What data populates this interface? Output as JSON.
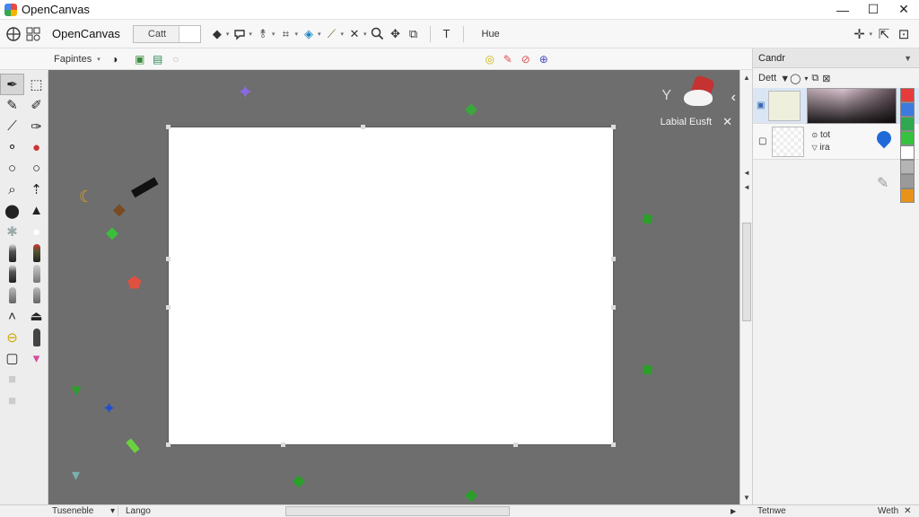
{
  "window": {
    "title": "OpenCanvas",
    "minimize": "—",
    "maximize": "☐",
    "close": "✕"
  },
  "toolbar": {
    "document_name": "OpenCanvas",
    "field_value": "Catt",
    "text_tool": "T",
    "hue_label": "Hue",
    "plus": "✛",
    "caret": "▾"
  },
  "toolbar2": {
    "brush_label": "Fapintes",
    "caret": "▾"
  },
  "workspace": {
    "label_edit": "Labial Eusft",
    "close_icon": "✕",
    "chevron": "‹",
    "y_mark": "Y"
  },
  "right_panel": {
    "tab": "Candr",
    "layers_label": "Dett",
    "layer2_line1": "tot",
    "layer2_line2": "ira",
    "swatch_colors": [
      "#e63b3b",
      "#3c7ae0",
      "#2fa84f",
      "#36c23e",
      "#ffffff",
      "#b4b4b4",
      "#9a9a9a",
      "#e8921a"
    ]
  },
  "status": {
    "select_value": "Tuseneble",
    "caret": "▾",
    "layer_label": "Lango",
    "right_label": "Tetnwe",
    "far_right_label": "Weth",
    "far_right_icon": "✕"
  },
  "colors": {
    "workspace_bg": "#6e6e6e",
    "canvas_bg": "#ffffff",
    "accent_blue": "#1f6ad8"
  }
}
